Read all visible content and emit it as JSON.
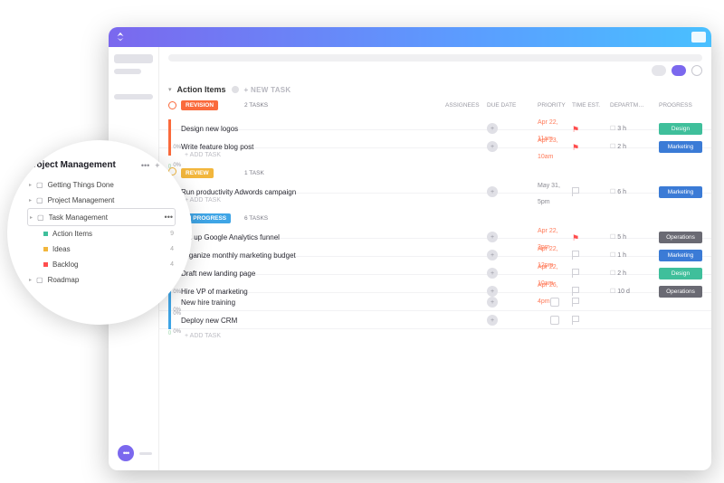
{
  "section": {
    "title": "Action Items",
    "new_task": "+ NEW TASK"
  },
  "columns": {
    "assignees": "ASSIGNEES",
    "due_date": "DUE DATE",
    "priority": "PRIORITY",
    "time_est": "TIME EST.",
    "department": "DEPARTM…",
    "progress": "PROGRESS"
  },
  "statuses": [
    {
      "name": "REVISION",
      "count": "2 TASKS",
      "bg": "#fa6a3c",
      "ring": "#fa6a3c",
      "tasks": [
        {
          "name": "Design new logos",
          "due": "Apr 22, 11am",
          "due_color": "#ff7a59",
          "flag": "#ff4d4d",
          "time": "3 h",
          "dept": "Design",
          "dept_bg": "#3fbf9b",
          "progress": "0%"
        },
        {
          "name": "Write feature blog post",
          "due": "Apr 23, 10am",
          "due_color": "#ff7a59",
          "flag": "#ff4d4d",
          "time": "2 h",
          "dept": "Marketing",
          "dept_bg": "#3b7bd6",
          "progress": "0%"
        }
      ]
    },
    {
      "name": "REVIEW",
      "count": "1 TASK",
      "bg": "#f2b63c",
      "ring": "#f2b63c",
      "tasks": [
        {
          "name": "Run productivity Adwords campaign",
          "due": "May 31, 5pm",
          "due_color": "#8a8a92",
          "flag": "",
          "time": "6 h",
          "dept": "Marketing",
          "dept_bg": "#3b7bd6",
          "progress": "0%"
        }
      ]
    },
    {
      "name": "IN PROGRESS",
      "count": "6 TASKS",
      "bg": "#3fa5e6",
      "ring": "#3fa5e6",
      "tasks": [
        {
          "name": "Set up Google Analytics funnel",
          "due": "Apr 22, 3pm",
          "due_color": "#ff7a59",
          "flag": "#ff4d4d",
          "time": "5 h",
          "dept": "Operations",
          "dept_bg": "#6a6a73",
          "progress": "0%"
        },
        {
          "name": "Organize monthly marketing budget",
          "due": "Apr 22, 12pm",
          "due_color": "#ff7a59",
          "flag": "",
          "time": "1 h",
          "dept": "Marketing",
          "dept_bg": "#3b7bd6",
          "progress": "0%"
        },
        {
          "name": "Draft new landing page",
          "due": "Apr 22, 10am",
          "due_color": "#ff7a59",
          "flag": "",
          "time": "2 h",
          "dept": "Design",
          "dept_bg": "#3fbf9b",
          "progress": "0%"
        },
        {
          "name": "Hire VP of marketing",
          "due": "Apr 26, 4pm",
          "due_color": "#ff7a59",
          "flag": "",
          "time": "10 d",
          "dept": "Operations",
          "dept_bg": "#6a6a73",
          "progress": "0%"
        },
        {
          "name": "New hire training",
          "due": "",
          "due_color": "",
          "flag": "",
          "time": "",
          "dept": "",
          "dept_bg": "",
          "progress": "0%"
        },
        {
          "name": "Deploy new CRM",
          "due": "",
          "due_color": "",
          "flag": "",
          "time": "",
          "dept": "",
          "dept_bg": "",
          "progress": "0%"
        }
      ]
    }
  ],
  "add_task": "+ ADD TASK",
  "sidebar": {
    "title": "Project Management",
    "items": [
      {
        "label": "Getting Things Done",
        "type": "folder"
      },
      {
        "label": "Project Management",
        "type": "folder"
      },
      {
        "label": "Task Management",
        "type": "folder",
        "selected": true
      },
      {
        "label": "Action Items",
        "type": "list",
        "color": "#3fbf9b",
        "count": "9"
      },
      {
        "label": "Ideas",
        "type": "list",
        "color": "#f2b63c",
        "count": "4"
      },
      {
        "label": "Backlog",
        "type": "list",
        "color": "#ff4d4d",
        "count": "4"
      },
      {
        "label": "Roadmap",
        "type": "folder"
      }
    ]
  }
}
